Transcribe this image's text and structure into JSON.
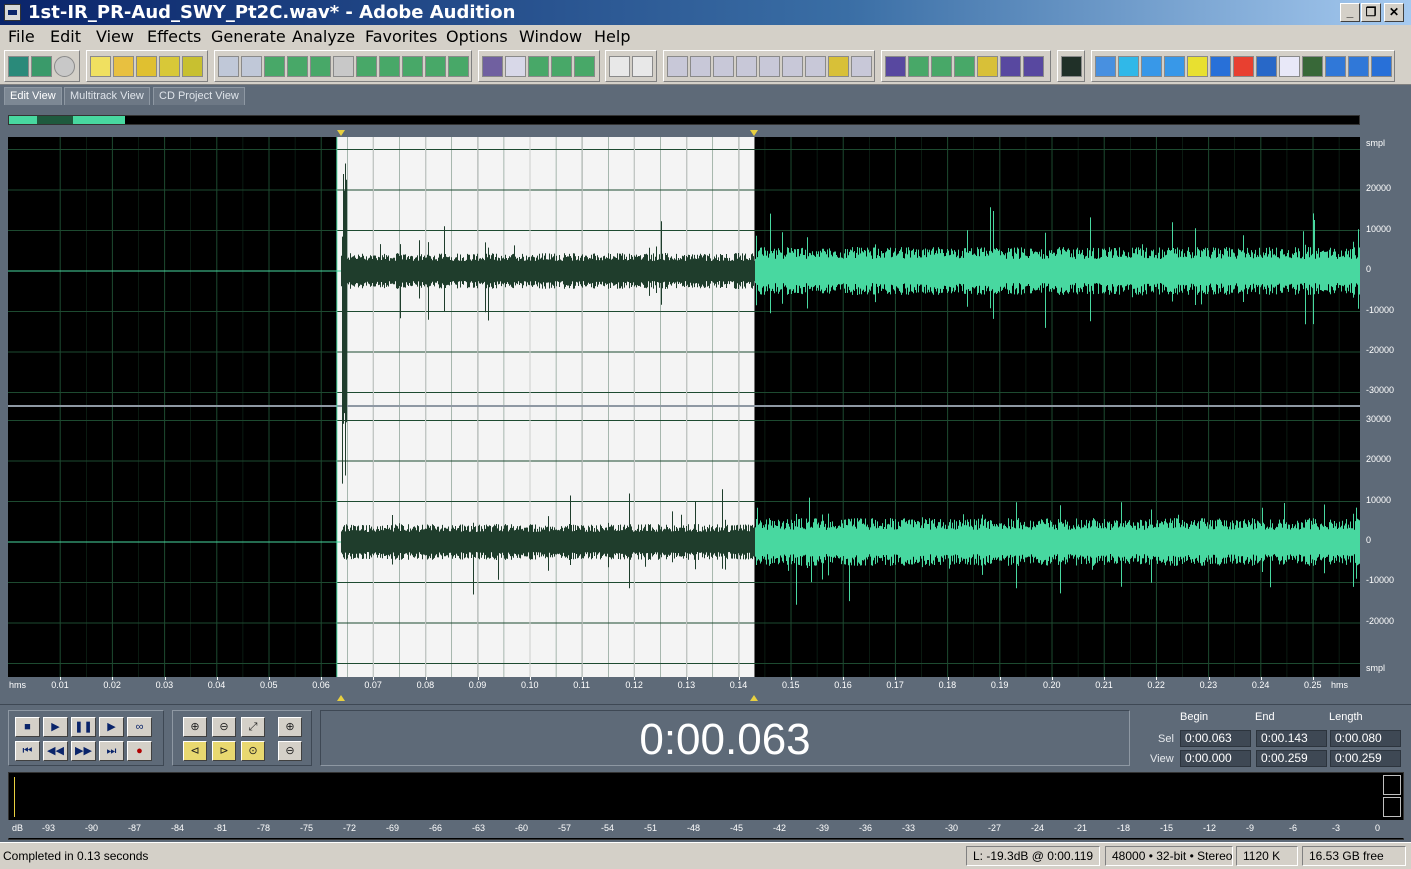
{
  "window": {
    "title": "1st-IR_PR-Aud_SWY_Pt2C.wav* - Adobe Audition",
    "controls": [
      "_",
      "❐",
      "✕"
    ]
  },
  "menu": [
    "File",
    "Edit",
    "View",
    "Effects",
    "Generate",
    "Analyze",
    "Favorites",
    "Options",
    "Window",
    "Help"
  ],
  "tabs": [
    {
      "label": "Edit View",
      "active": true
    },
    {
      "label": "Multitrack View",
      "active": false
    },
    {
      "label": "CD Project View",
      "active": false
    }
  ],
  "waveform": {
    "amplitude_units": "smpl",
    "channel_top_scale": [
      "20000",
      "10000",
      "0",
      "-10000",
      "-20000",
      "-30000"
    ],
    "channel_bottom_scale": [
      "30000",
      "20000",
      "10000",
      "0",
      "-10000",
      "-20000"
    ],
    "time_unit": "hms",
    "time_ticks": [
      "0.01",
      "0.02",
      "0.03",
      "0.04",
      "0.05",
      "0.06",
      "0.07",
      "0.08",
      "0.09",
      "0.10",
      "0.11",
      "0.12",
      "0.13",
      "0.14",
      "0.15",
      "0.16",
      "0.17",
      "0.18",
      "0.19",
      "0.20",
      "0.21",
      "0.22",
      "0.23",
      "0.24",
      "0.25"
    ],
    "selection_start_seconds": 0.063,
    "selection_end_seconds": 0.143,
    "view_end_seconds": 0.259,
    "colors": {
      "background": "#000000",
      "selection_background": "#f4f4f4",
      "wave_unselected": "#48d8a0",
      "wave_selected": "#1f3d2c",
      "grid": "#1d4a30"
    }
  },
  "transport": {
    "time_display": "0:00.063"
  },
  "selection_view": {
    "headers": {
      "begin": "Begin",
      "end": "End",
      "length": "Length"
    },
    "sel": {
      "label": "Sel",
      "begin": "0:00.063",
      "end": "0:00.143",
      "length": "0:00.080"
    },
    "view": {
      "label": "View",
      "begin": "0:00.000",
      "end": "0:00.259",
      "length": "0:00.259"
    }
  },
  "level_meter": {
    "unit": "dB",
    "ticks": [
      "-93",
      "-90",
      "-87",
      "-84",
      "-81",
      "-78",
      "-75",
      "-72",
      "-69",
      "-66",
      "-63",
      "-60",
      "-57",
      "-54",
      "-51",
      "-48",
      "-45",
      "-42",
      "-39",
      "-36",
      "-33",
      "-30",
      "-27",
      "-24",
      "-21",
      "-18",
      "-15",
      "-12",
      "-9",
      "-6",
      "-3",
      "0"
    ]
  },
  "status": {
    "message": "Completed in 0.13 seconds",
    "level": "L: -19.3dB @  0:00.119",
    "format": "48000 • 32-bit • Stereo",
    "size": "1120 K",
    "free": "16.53 GB free"
  }
}
